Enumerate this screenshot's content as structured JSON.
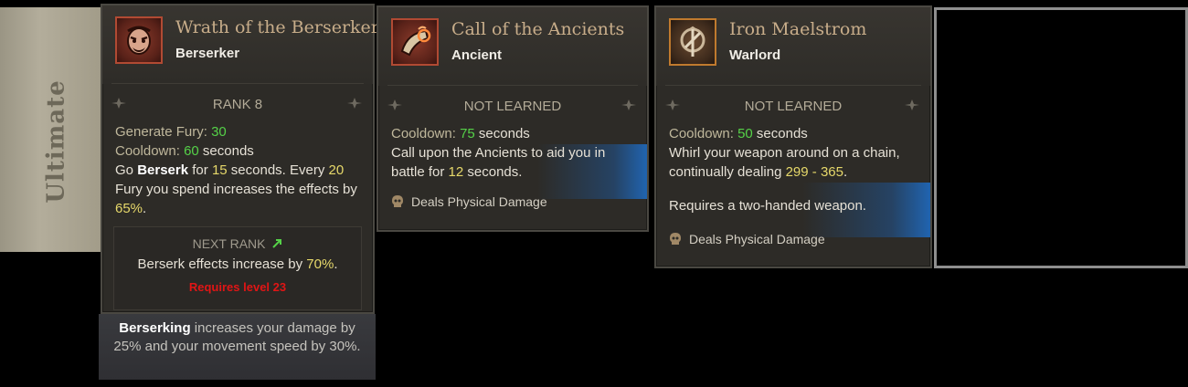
{
  "side_tab": {
    "label": "Ultimate"
  },
  "cards": [
    {
      "title": "Wrath of the Berserker",
      "subtitle": "Berserker",
      "icon": "berserker-face-icon",
      "rank": "RANK 8",
      "stats": {
        "fury_label": "Generate Fury:",
        "fury_value": "30",
        "cooldown_label": "Cooldown:",
        "cooldown_value": "60",
        "cooldown_unit": "seconds"
      },
      "desc": {
        "p1": "Go",
        "keyword": "Berserk",
        "p2": "for",
        "dur": "15",
        "p3": "seconds. Every",
        "fury": "20",
        "p4": "Fury you spend increases the effects by",
        "pct": "65%",
        "p5": "."
      },
      "next_rank": {
        "heading": "NEXT RANK",
        "text_pre": "Berserk effects increase by",
        "value": "70%",
        "text_post": ".",
        "requirement": "Requires level 23"
      },
      "footer": {
        "keyword": "Berserking",
        "text": "increases your damage by 25% and your movement speed by 30%."
      }
    },
    {
      "title": "Call of the Ancients",
      "subtitle": "Ancient",
      "icon": "horn-icon",
      "rank": "NOT LEARNED",
      "stats": {
        "cooldown_label": "Cooldown:",
        "cooldown_value": "75",
        "cooldown_unit": "seconds"
      },
      "desc": {
        "p1": "Call upon the Ancients to aid you in battle for",
        "dur": "12",
        "p2": "seconds."
      },
      "damage_type": "Deals Physical Damage"
    },
    {
      "title": "Iron Maelstrom",
      "subtitle": "Warlord",
      "icon": "chain-weapon-icon",
      "rank": "NOT LEARNED",
      "stats": {
        "cooldown_label": "Cooldown:",
        "cooldown_value": "50",
        "cooldown_unit": "seconds"
      },
      "desc": {
        "p1": "Whirl your weapon around on a chain, continually dealing",
        "range": "299 - 365",
        "p2": "."
      },
      "requirement": "Requires a two-handed weapon.",
      "damage_type": "Deals Physical Damage"
    }
  ],
  "colors": {
    "highlight_green": "#55d148",
    "highlight_yellow": "#e6d86a",
    "requirement_red": "#e01515",
    "title_tan": "#c8ad8a"
  }
}
